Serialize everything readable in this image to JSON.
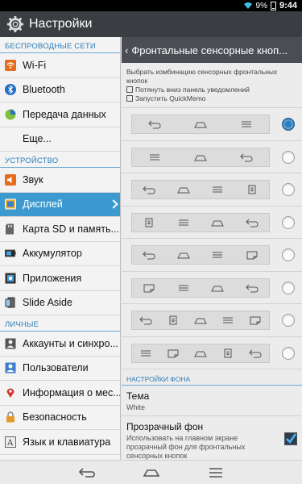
{
  "status": {
    "battery": "9%",
    "time": "9:44"
  },
  "app": {
    "title": "Настройки"
  },
  "left": {
    "sections": [
      {
        "title": "БЕСПРОВОДНЫЕ СЕТИ",
        "items": [
          {
            "label": "Wi-Fi",
            "icon": "wifi-icon"
          },
          {
            "label": "Bluetooth",
            "icon": "bluetooth-icon"
          },
          {
            "label": "Передача данных",
            "icon": "data-usage-icon"
          },
          {
            "label": "Еще...",
            "icon": ""
          }
        ]
      },
      {
        "title": "УСТРОЙСТВО",
        "items": [
          {
            "label": "Звук",
            "icon": "sound-icon"
          },
          {
            "label": "Дисплей",
            "icon": "display-icon"
          },
          {
            "label": "Карта SD и память...",
            "icon": "storage-icon"
          },
          {
            "label": "Аккумулятор",
            "icon": "battery-icon"
          },
          {
            "label": "Приложения",
            "icon": "apps-icon"
          },
          {
            "label": "Slide Aside",
            "icon": "slide-aside-icon"
          }
        ]
      },
      {
        "title": "ЛИЧНЫЕ",
        "items": [
          {
            "label": "Аккаунты и синхро...",
            "icon": "accounts-icon"
          },
          {
            "label": "Пользователи",
            "icon": "users-icon"
          },
          {
            "label": "Информация о мес...",
            "icon": "location-icon"
          },
          {
            "label": "Безопасность",
            "icon": "security-icon"
          },
          {
            "label": "Язык и клавиатура",
            "icon": "language-icon"
          }
        ]
      }
    ]
  },
  "right": {
    "title": "Фронтальные сенсорные кноп...",
    "hint": {
      "line1": "Выбрать комбинацию сенсорных фронтальных кнопок",
      "line2": "Потянуть вниз панель уведомлений",
      "line3": "Запустить QuickMemo"
    },
    "options": [
      {
        "buttons": [
          "back",
          "home",
          "menu"
        ],
        "selected": true
      },
      {
        "buttons": [
          "menu",
          "home",
          "back"
        ],
        "selected": false
      },
      {
        "buttons": [
          "back",
          "home",
          "menu",
          "notif"
        ],
        "selected": false
      },
      {
        "buttons": [
          "notif",
          "menu",
          "home",
          "back"
        ],
        "selected": false
      },
      {
        "buttons": [
          "back",
          "home",
          "menu",
          "memo"
        ],
        "selected": false
      },
      {
        "buttons": [
          "memo",
          "menu",
          "home",
          "back"
        ],
        "selected": false
      },
      {
        "buttons": [
          "back",
          "notif",
          "home",
          "menu",
          "memo"
        ],
        "selected": false
      },
      {
        "buttons": [
          "menu",
          "memo",
          "home",
          "notif",
          "back"
        ],
        "selected": false
      }
    ],
    "bg_section": "НАСТРОЙКИ ФОНА",
    "theme": {
      "title": "Тема",
      "value": "White"
    },
    "transparent": {
      "title": "Прозрачный фон",
      "desc": "Использовать на главном экране прозрачный фон для фронтальных сенсорных кнопок",
      "checked": true
    }
  },
  "colors": {
    "accent": "#3d9ad1",
    "section": "#2c7fb8"
  }
}
